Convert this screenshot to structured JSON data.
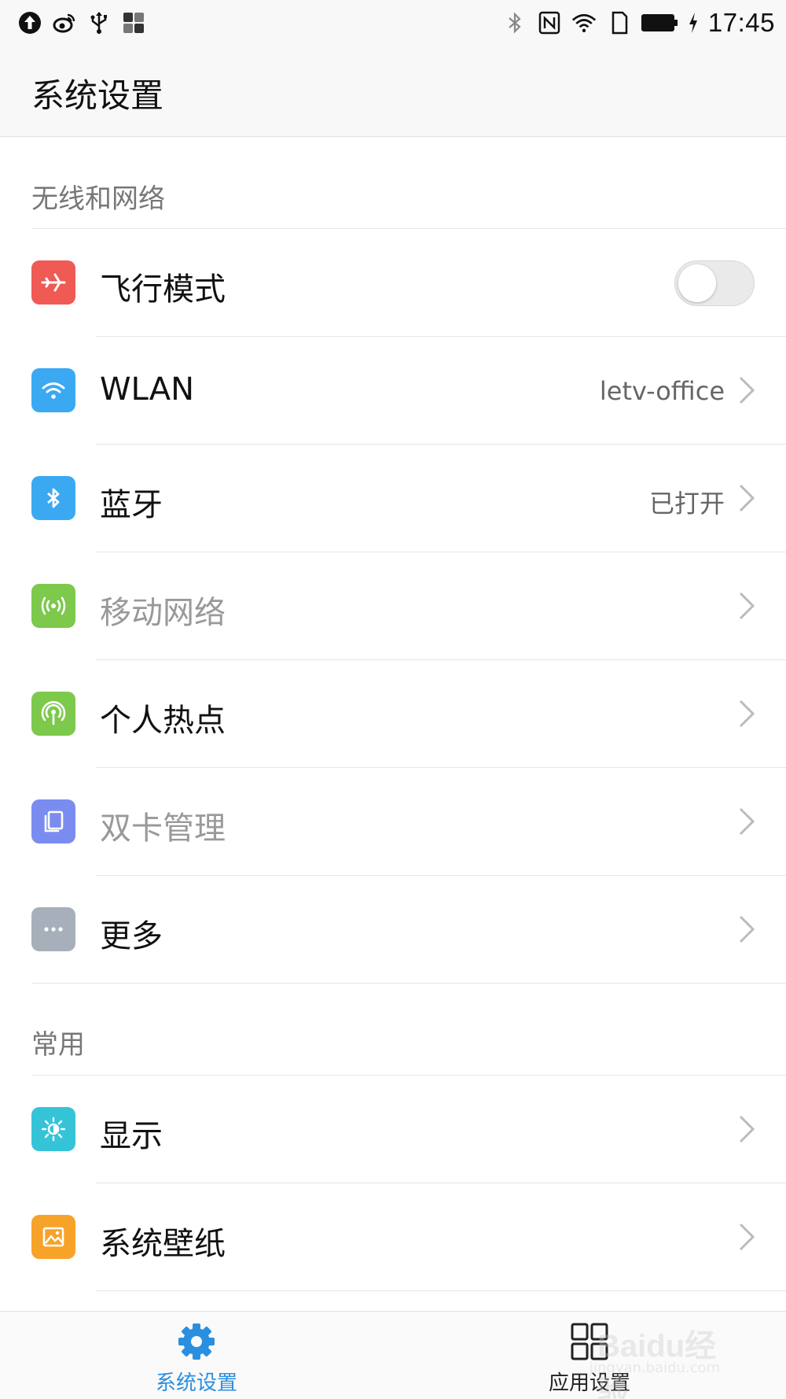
{
  "status_bar": {
    "time": "17:45",
    "left_icons": [
      "upload-icon",
      "weibo-icon",
      "usb-icon",
      "grid-app-icon"
    ],
    "right_icons": [
      "bluetooth-icon",
      "nfc-icon",
      "wifi-icon",
      "sim-icon",
      "battery-icon",
      "charging-icon"
    ]
  },
  "header": {
    "title": "系统设置"
  },
  "sections": {
    "wireless": {
      "label": "无线和网络"
    },
    "common": {
      "label": "常用"
    }
  },
  "rows": {
    "airplane": {
      "label": "飞行模式",
      "icon": "airplane-icon",
      "color": "#ef5a55",
      "toggle_on": false
    },
    "wlan": {
      "label": "WLAN",
      "value": "letv-office",
      "icon": "wifi-icon",
      "color": "#3aa9f2"
    },
    "bluetooth": {
      "label": "蓝牙",
      "value": "已打开",
      "icon": "bluetooth-icon",
      "color": "#3aa9f2"
    },
    "mobile": {
      "label": "移动网络",
      "icon": "signal-icon",
      "color": "#7cc94c",
      "disabled": true
    },
    "hotspot": {
      "label": "个人热点",
      "icon": "hotspot-icon",
      "color": "#7cc94c"
    },
    "dualsim": {
      "label": "双卡管理",
      "icon": "sim-cards-icon",
      "color": "#7b8cf0",
      "disabled": true
    },
    "more": {
      "label": "更多",
      "icon": "more-dots-icon",
      "color": "#a7b0ba"
    },
    "display": {
      "label": "显示",
      "icon": "brightness-icon",
      "color": "#35c3d8"
    },
    "wallpaper": {
      "label": "系统壁纸",
      "icon": "wallpaper-icon",
      "color": "#f7a32a"
    }
  },
  "bottom_nav": {
    "system": {
      "label": "系统设置",
      "icon": "gear-icon",
      "color": "#2b8fe0",
      "active": true
    },
    "apps": {
      "label": "应用设置",
      "icon": "grid-icon",
      "active": false
    }
  },
  "watermark": {
    "text": "Baidu经验",
    "sub": "jingyan.baidu.com"
  }
}
